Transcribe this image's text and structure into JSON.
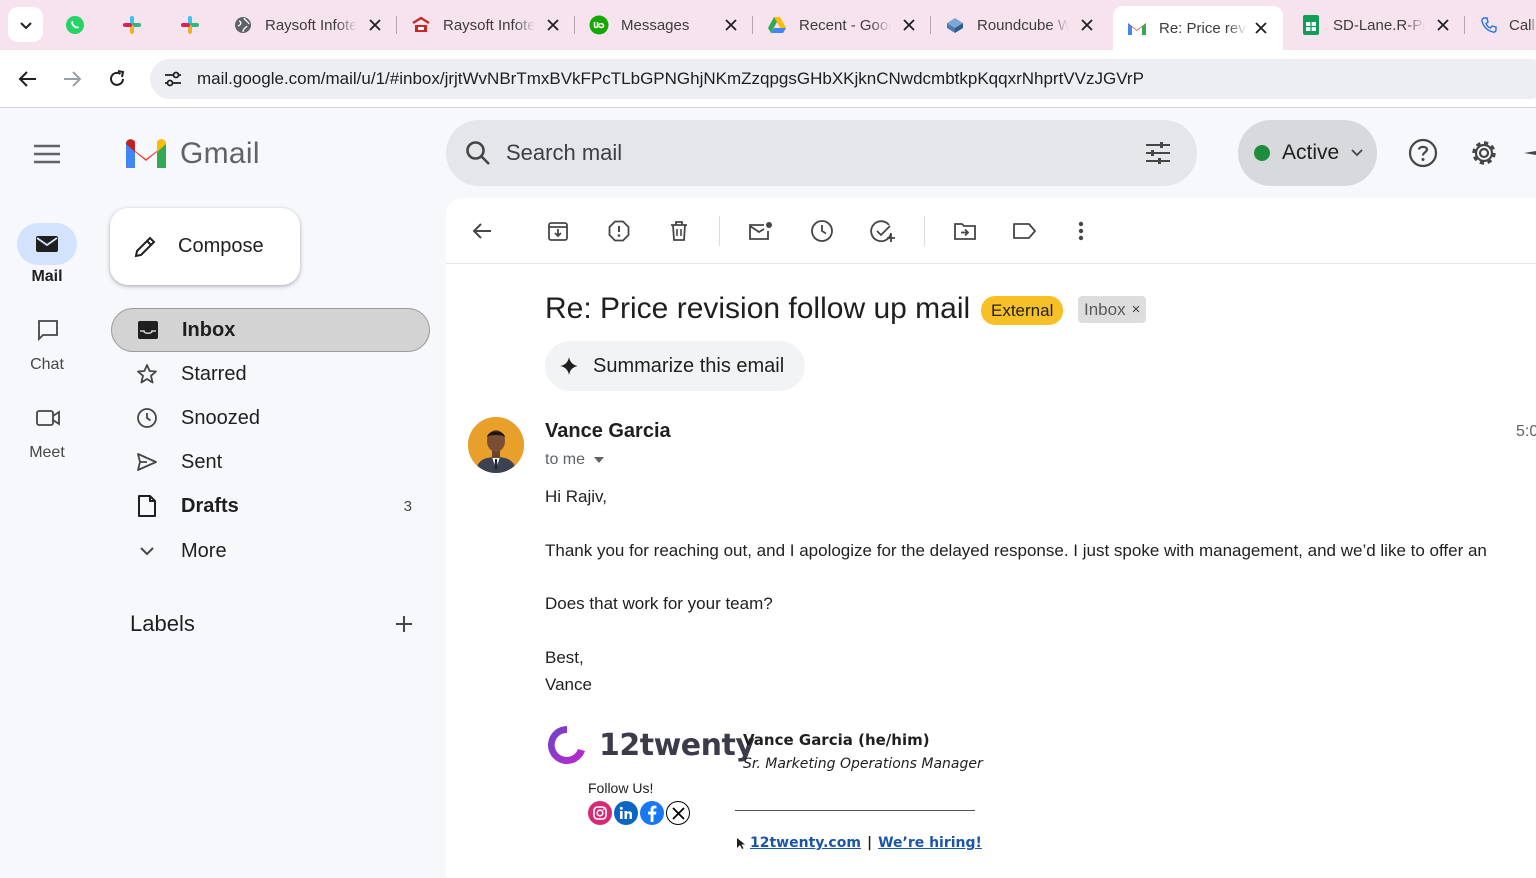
{
  "browser": {
    "tabs": [
      {
        "title": "Raysoft Infotech",
        "icon": "globe-icon"
      },
      {
        "title": "Raysoft Infotech",
        "icon": "raysoft-logo-icon"
      },
      {
        "title": "Messages",
        "icon": "upwork-logo-icon"
      },
      {
        "title": "Recent - Google Drive",
        "icon": "google-drive-icon"
      },
      {
        "title": "Roundcube Webmail",
        "icon": "roundcube-icon"
      },
      {
        "title": "Re: Price revision",
        "icon": "gmail-icon",
        "active": true
      },
      {
        "title": "SD-Lane.R-Price",
        "icon": "google-sheets-icon"
      },
      {
        "title": "Call",
        "icon": "phone-icon"
      }
    ],
    "url": "mail.google.com/mail/u/1/#inbox/jrjtWvNBrTmxBVkFPcTLbGPNGhjNKmZzqpgsGHbXKjknCNwdcmbtkpKqqxrNhprtVVzJGVrP"
  },
  "rail": {
    "items": [
      {
        "label": "Mail",
        "icon": "mail-icon",
        "selected": true
      },
      {
        "label": "Chat",
        "icon": "chat-icon"
      },
      {
        "label": "Meet",
        "icon": "video-icon"
      }
    ]
  },
  "app": {
    "name": "Gmail"
  },
  "compose": {
    "label": "Compose"
  },
  "folders": [
    {
      "label": "Inbox",
      "icon": "inbox-icon",
      "selected": true,
      "bold": true
    },
    {
      "label": "Starred",
      "icon": "star-icon"
    },
    {
      "label": "Snoozed",
      "icon": "clock-icon"
    },
    {
      "label": "Sent",
      "icon": "send-icon"
    },
    {
      "label": "Drafts",
      "icon": "draft-icon",
      "bold": true,
      "count": "3"
    },
    {
      "label": "More",
      "icon": "chevron-down-icon"
    }
  ],
  "labels": {
    "heading": "Labels"
  },
  "search": {
    "placeholder": "Search mail"
  },
  "status": {
    "label": "Active",
    "color": "#1e8e3e"
  },
  "email": {
    "subject": "Re: Price revision follow up mail",
    "external_chip": "External",
    "inbox_chip": "Inbox",
    "inbox_chip_close": "×",
    "summarize_label": "Summarize this email",
    "sender": "Vance Garcia",
    "recipients": "to me",
    "time": "5:0",
    "body": [
      "Hi Rajiv,",
      "Thank you for reaching out, and I apologize for the delayed response. I just spoke with management, and we’d like to offer an",
      "Does that work for your team?",
      "Best,",
      "Vance"
    ],
    "signature": {
      "brand": "12twenty",
      "name": "Vance Garcia (he/him)",
      "title": "Sr. Marketing Operations Manager",
      "follow": "Follow Us!",
      "social": [
        "instagram-icon",
        "linkedin-icon",
        "facebook-icon",
        "x-icon"
      ],
      "link1": "12twenty.com",
      "separator": "|",
      "link2": "We’re hiring!"
    }
  },
  "colors": {
    "tabbar_bg": "#f7e3ee",
    "accent_blue": "#d3e3fd",
    "external_chip": "#f6c026",
    "gmail_red": "#ea4335",
    "link": "#1a55a8"
  }
}
